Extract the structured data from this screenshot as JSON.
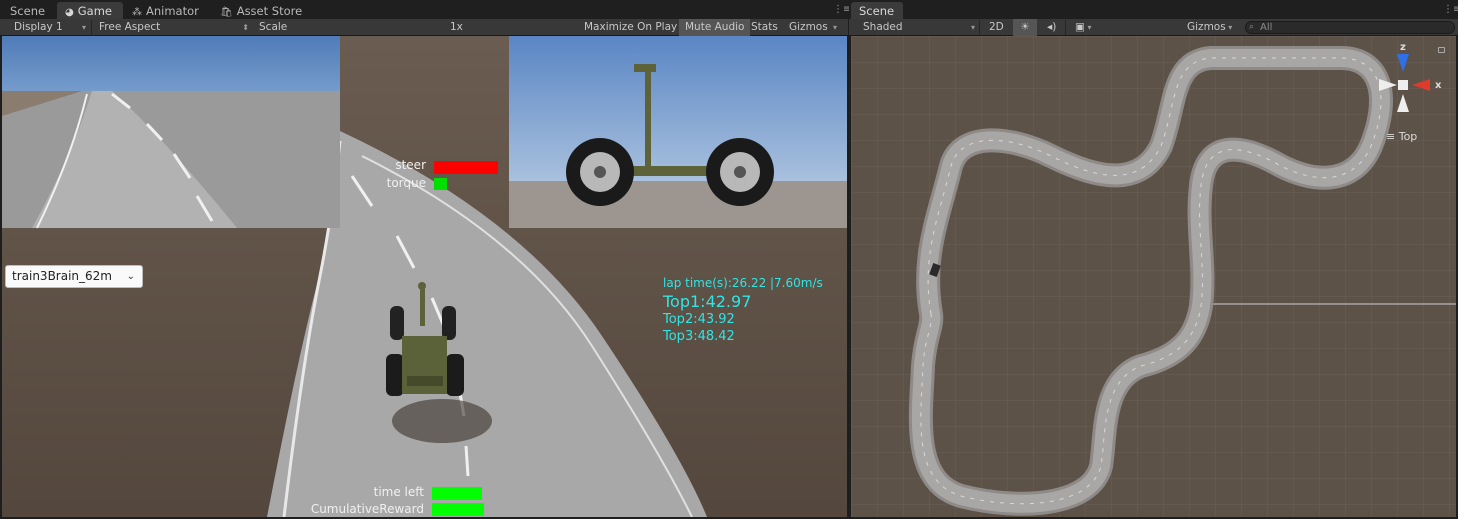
{
  "left_tabs": [
    {
      "label": "Scene",
      "active": false
    },
    {
      "label": "Game",
      "active": true
    },
    {
      "label": "Animator",
      "active": false
    },
    {
      "label": "Asset Store",
      "active": false
    }
  ],
  "right_tabs": [
    {
      "label": "Scene",
      "active": true
    }
  ],
  "game_toolbar": {
    "display": "Display 1",
    "aspect": "Free Aspect",
    "scale_label": "Scale",
    "scale_value": "1x",
    "maximize": "Maximize On Play",
    "mute": "Mute Audio",
    "stats": "Stats",
    "gizmos": "Gizmos"
  },
  "scene_toolbar": {
    "shading": "Shaded",
    "mode_2d": "2D",
    "gizmos": "Gizmos",
    "search_placeholder": "All"
  },
  "hud": {
    "steer_label": "steer",
    "torque_label": "torque",
    "steer_value": 1.0,
    "torque_value": 0.2,
    "lap_time": "lap time(s):26.22",
    "speed": "|7.60m/s",
    "top1": "Top1:42.97",
    "top2": "Top2:43.92",
    "top3": "Top3:48.42",
    "time_left_label": "time left",
    "reward_label": "CumulativeReward"
  },
  "brain_dropdown": {
    "selected": "train3Brain_62m"
  },
  "gizmo": {
    "z_label": "z",
    "x_label": "x",
    "view_label": "Top"
  },
  "colors": {
    "steer_bar": "#ff0000",
    "torque_bar": "#00e000",
    "time_left_bar": "#00ff00",
    "reward_bar": "#00ff00",
    "hud_cyan": "#2ee6e6"
  }
}
